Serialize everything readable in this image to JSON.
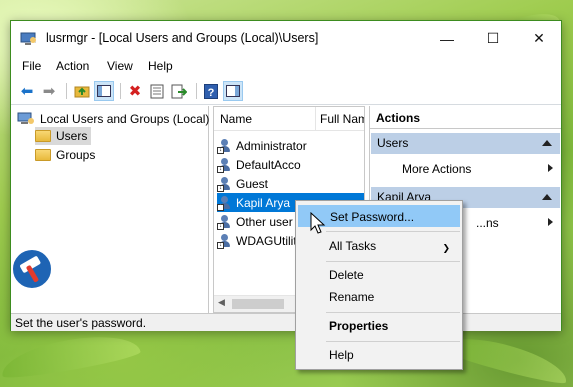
{
  "window": {
    "title": "lusrmgr - [Local Users and Groups (Local)\\Users]",
    "controls": {
      "minimize": "—",
      "maximize": "☐",
      "close": "✕"
    }
  },
  "menu": [
    "File",
    "Action",
    "View",
    "Help"
  ],
  "toolbar": {
    "icons": [
      "back-arrow-icon",
      "forward-arrow-icon",
      "up-folder-icon",
      "show-hide-tree-icon",
      "delete-icon",
      "properties-icon",
      "export-list-icon",
      "help-icon",
      "show-hide-action-pane-icon"
    ]
  },
  "tree": {
    "root": "Local Users and Groups (Local)",
    "children": [
      {
        "label": "Users",
        "selected": true
      },
      {
        "label": "Groups",
        "selected": false
      }
    ]
  },
  "list": {
    "columns": [
      "Name",
      "Full Nam"
    ],
    "rows": [
      {
        "name": "Administrator",
        "selected": false
      },
      {
        "name": "DefaultAcco",
        "selected": false
      },
      {
        "name": "Guest",
        "selected": false
      },
      {
        "name": "Kapil Arya",
        "selected": true
      },
      {
        "name": "Other user",
        "selected": false
      },
      {
        "name": "WDAGUtilit",
        "selected": false
      }
    ]
  },
  "actions": {
    "header": "Actions",
    "sections": [
      {
        "title": "Users",
        "items": [
          "More Actions"
        ]
      },
      {
        "title": "Kapil Arya",
        "items": [
          "...ns"
        ]
      }
    ]
  },
  "status": "Set the user's password.",
  "context_menu": {
    "items": [
      {
        "label": "Set Password...",
        "highlighted": true
      },
      {
        "label": "All Tasks",
        "submenu": true
      },
      {
        "label": "Delete"
      },
      {
        "label": "Rename"
      },
      {
        "label": "Properties",
        "bold": true
      },
      {
        "label": "Help"
      }
    ]
  },
  "colors": {
    "selection": "#0078d7",
    "action_section": "#bccfe6",
    "menu_highlight": "#91c9f7",
    "window_border": "#3d8c1f"
  }
}
